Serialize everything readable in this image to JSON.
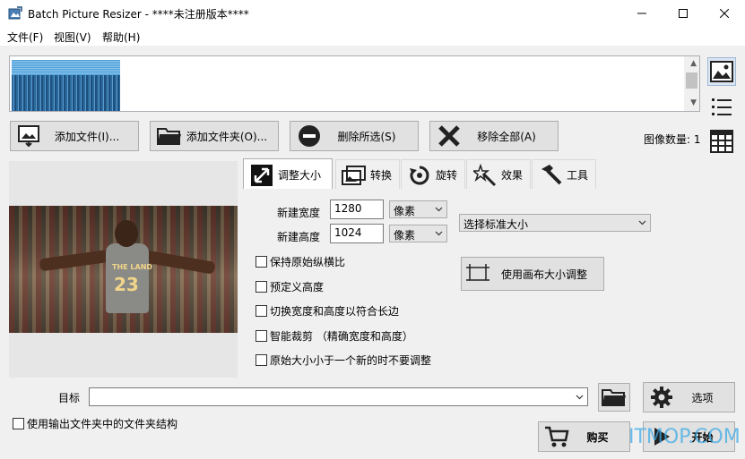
{
  "window": {
    "title": "Batch Picture Resizer - ****未注册版本****"
  },
  "menu": {
    "items": [
      {
        "label": "文件(F)"
      },
      {
        "label": "视图(V)"
      },
      {
        "label": "帮助(H)"
      }
    ]
  },
  "toolbar": {
    "add_files": "添加文件(I)...",
    "add_folder": "添加文件夹(O)...",
    "delete_selected": "删除所选(S)",
    "remove_all": "移除全部(A)",
    "image_count": "图像数量: 1"
  },
  "preview": {
    "jersey_team": "THE LAND",
    "jersey_number": "23"
  },
  "tabs": [
    {
      "label": "调整大小",
      "icon": "resize-icon",
      "active": true
    },
    {
      "label": "转换",
      "icon": "convert-icon",
      "active": false
    },
    {
      "label": "旋转",
      "icon": "rotate-icon",
      "active": false
    },
    {
      "label": "效果",
      "icon": "effects-icon",
      "active": false
    },
    {
      "label": "工具",
      "icon": "tools-icon",
      "active": false
    }
  ],
  "resize": {
    "new_width_label": "新建宽度",
    "new_width_value": "1280",
    "width_unit": "像素",
    "new_height_label": "新建高度",
    "new_height_value": "1024",
    "height_unit": "像素",
    "standard_size": "选择标准大小",
    "keep_aspect": "保持原始纵横比",
    "predefined_height": "预定义高度",
    "swap_dims": "切换宽度和高度以符合长边",
    "smart_crop": "智能裁剪 （精确宽度和高度）",
    "no_upscale": "原始大小小于一个新的时不要调整",
    "canvas_button": "使用画布大小调整"
  },
  "output": {
    "target_label": "目标",
    "target_value": "",
    "options_button": "选项",
    "use_folder_structure": "使用输出文件夹中的文件夹结构",
    "buy_button": "购买",
    "start_button": "开始",
    "watermark": "ITMOP.COM"
  }
}
